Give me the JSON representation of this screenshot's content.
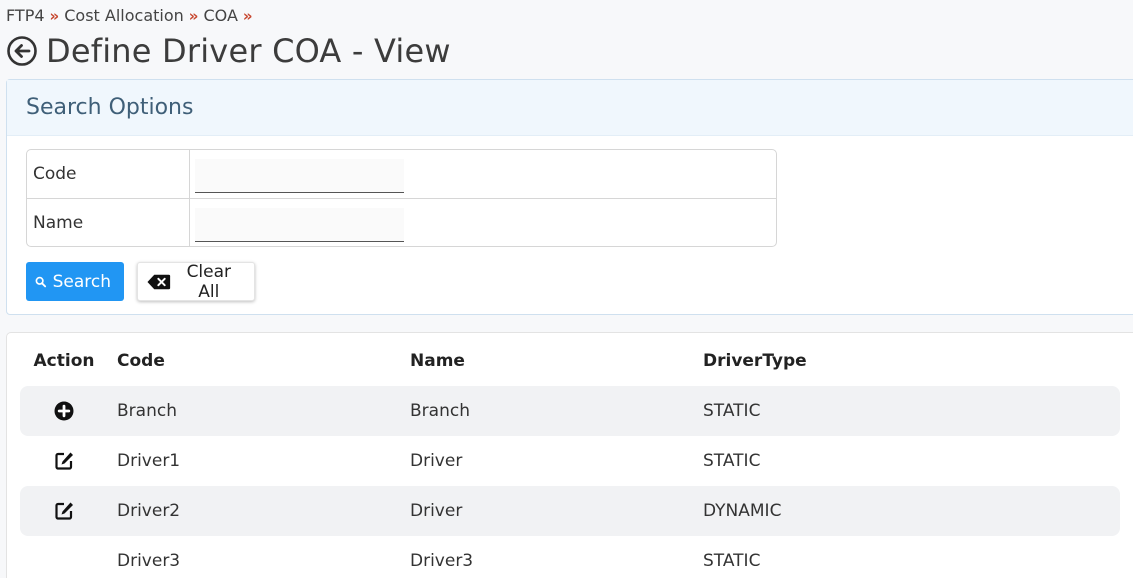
{
  "breadcrumb": {
    "items": [
      "FTP4",
      "Cost Allocation",
      "COA"
    ],
    "separator": "»"
  },
  "page": {
    "title": "Define Driver COA - View"
  },
  "search": {
    "heading": "Search Options",
    "fields": [
      {
        "label": "Code",
        "value": "",
        "placeholder": ""
      },
      {
        "label": "Name",
        "value": "",
        "placeholder": ""
      }
    ],
    "search_label": "Search",
    "clear_label": "Clear All"
  },
  "grid": {
    "columns": [
      "Action",
      "Code",
      "Name",
      "DriverType"
    ],
    "rows": [
      {
        "action_icon": "plus-circle-icon",
        "code": "Branch",
        "name": "Branch",
        "driver_type": "STATIC"
      },
      {
        "action_icon": "edit-icon",
        "code": "Driver1",
        "name": "Driver",
        "driver_type": "STATIC"
      },
      {
        "action_icon": "edit-icon",
        "code": "Driver2",
        "name": "Driver",
        "driver_type": "DYNAMIC"
      },
      {
        "action_icon": "",
        "code": "Driver3",
        "name": "Driver3",
        "driver_type": "STATIC"
      }
    ]
  },
  "colors": {
    "accent": "#2196f3",
    "breadcrumb_separator": "#c7472f",
    "search_header_bg": "#f0f7fd",
    "alt_row_bg": "#f1f2f4"
  }
}
